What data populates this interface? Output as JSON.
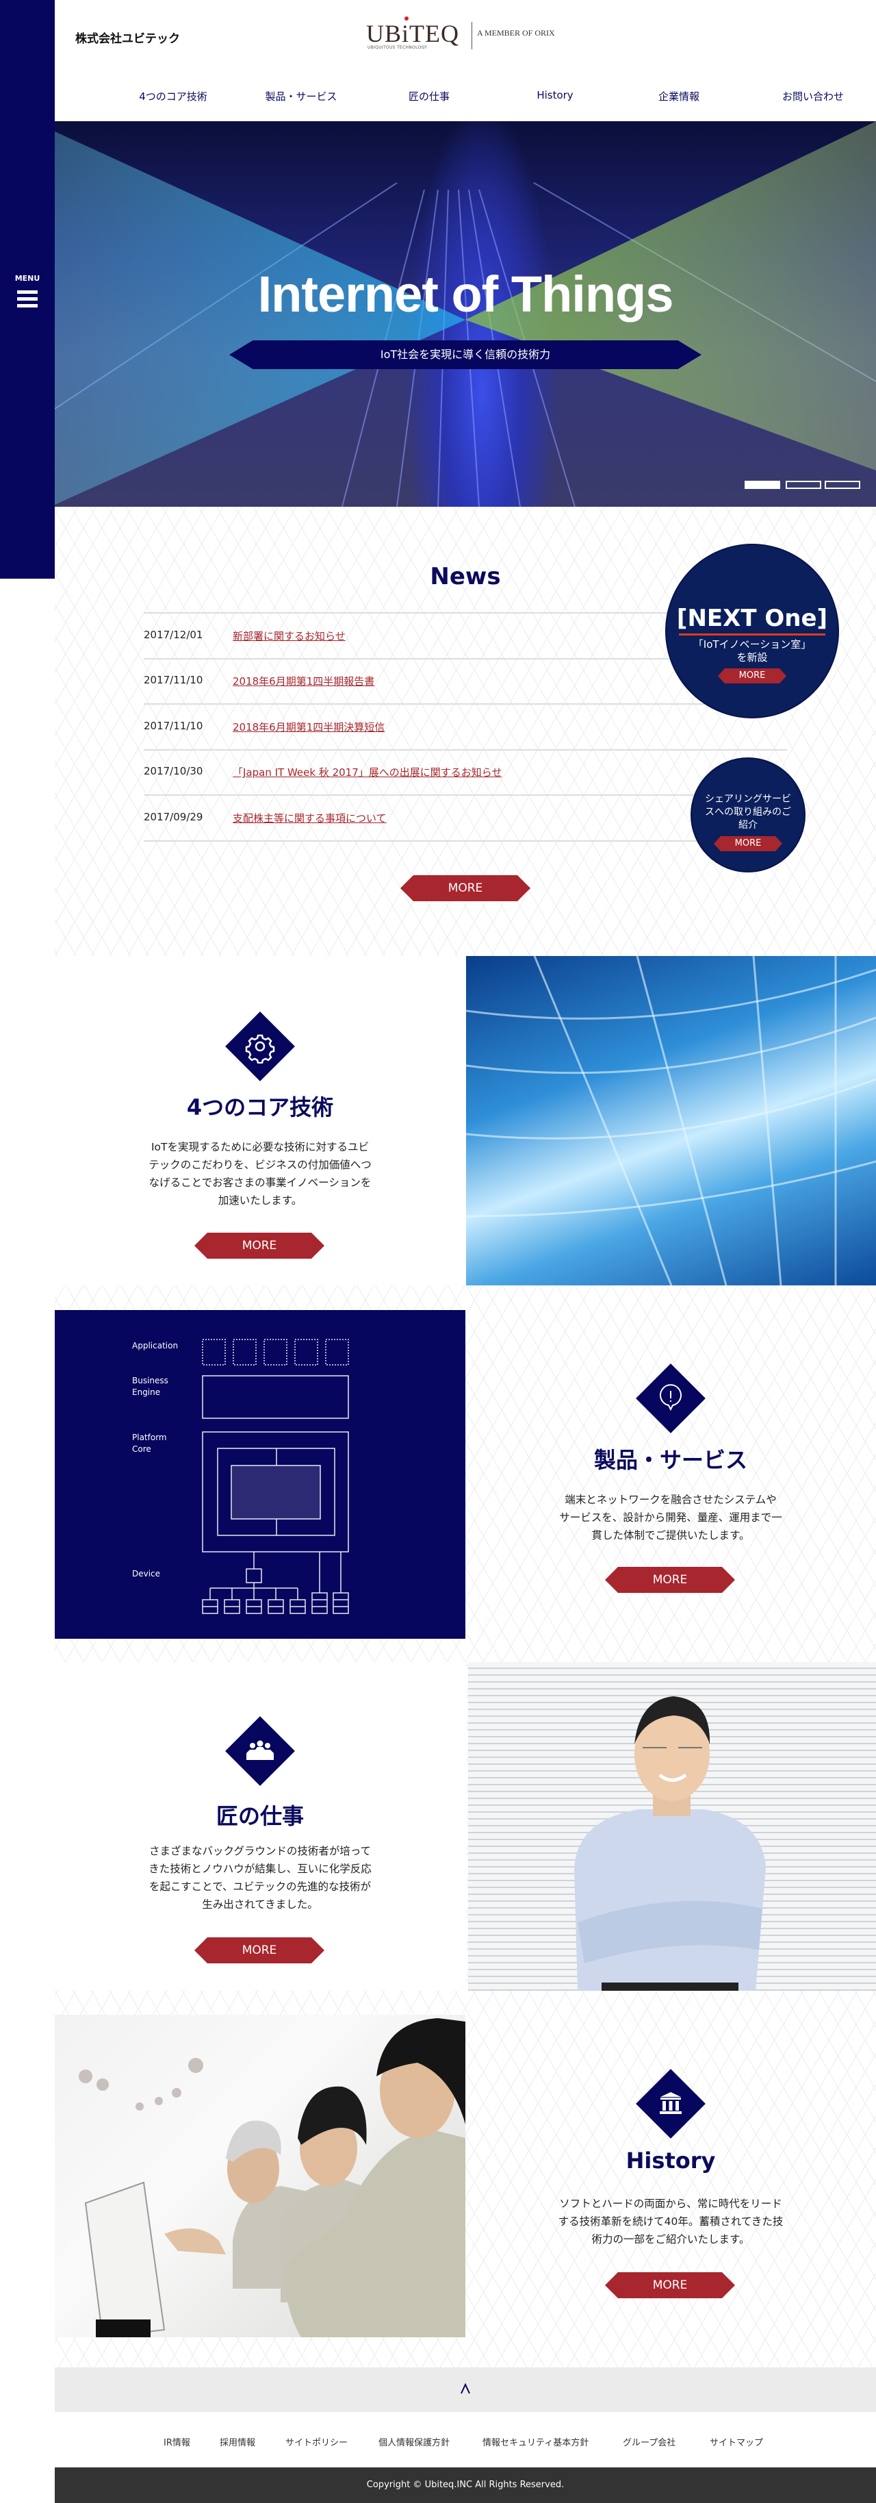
{
  "header": {
    "company_name": "株式会社ユビテック",
    "logo": {
      "brand": "UBiTEQ",
      "tagline": "UBIQUITOUS TECHNOLOGY",
      "member": "A MEMBER OF ORIX"
    },
    "nav": [
      "4つのコア技術",
      "製品・サービス",
      "匠の仕事",
      "History",
      "企業情報",
      "お問い合わせ"
    ]
  },
  "sidebar": {
    "menu_label": "MENU",
    "icon": "hamburger-icon"
  },
  "hero": {
    "title": "Internet of Things",
    "subtitle": "IoT社会を実現に導く信頼の技術力",
    "slides": {
      "count": 3,
      "active": 1
    }
  },
  "news": {
    "title": "News",
    "more": "MORE",
    "items": [
      {
        "date": "2017/12/01",
        "title": "新部署に関するお知らせ"
      },
      {
        "date": "2017/11/10",
        "title": "2018年6月期第1四半期報告書"
      },
      {
        "date": "2017/11/10",
        "title": "2018年6月期第1四半期決算短信"
      },
      {
        "date": "2017/10/30",
        "title": "「Japan IT Week 秋 2017」展への出展に関するお知らせ"
      },
      {
        "date": "2017/09/29",
        "title": "支配株主等に関する事項について"
      }
    ]
  },
  "promos": [
    {
      "title": "[NEXT One]",
      "lines": [
        "「IoTイノベーション室」",
        "を新設"
      ],
      "more": "MORE"
    },
    {
      "lines": [
        "シェアリングサービ",
        "スへの取り組みのご",
        "紹介"
      ],
      "more": "MORE"
    }
  ],
  "sections": [
    {
      "title": "4つのコア技術",
      "icon": "gear-icon",
      "lines": [
        "IoTを実現するために必要な技術に対するユビ",
        "テックのこだわりを、ビジネスの付加価値へつ",
        "なげることでお客さまの事業イノベーションを",
        "加速いたします。"
      ],
      "more": "MORE"
    },
    {
      "title": "製品・サービス",
      "icon": "speech-bubble-exclamation-icon",
      "lines": [
        "端末とネットワークを融合させたシステムや",
        "サービスを、設計から開発、量産、運用まで一",
        "貫した体制でご提供いたします。"
      ],
      "more": "MORE"
    },
    {
      "title": "匠の仕事",
      "icon": "team-icon",
      "lines": [
        "さまざまなバックグラウンドの技術者が培って",
        "きた技術とノウハウが結集し、互いに化学反応",
        "を起こすことで、ユビテックの先進的な技術が",
        "生み出されてきました。"
      ],
      "more": "MORE"
    },
    {
      "title": "History",
      "icon": "museum-icon",
      "lines": [
        "ソフトとハードの両面から、常に時代をリード",
        "する技術革新を続けて40年。蓄積されてきた技",
        "術力の一部をご紹介いたします。"
      ],
      "more": "MORE"
    }
  ],
  "diagram": {
    "application": "Application",
    "business": [
      "Business",
      "Engine"
    ],
    "platform": [
      "Platform",
      "Core"
    ],
    "device": "Device"
  },
  "footer": {
    "to_top_icon": "chevron-up-icon",
    "links": [
      "IR情報",
      "採用情報",
      "サイトポリシー",
      "個人情報保護方針",
      "情報セキュリティ基本方針",
      "グループ会社",
      "サイトマップ"
    ],
    "copyright": "Copyright © Ubiteq.INC All Rights Reserved."
  },
  "colors": {
    "navy": "#07065e",
    "accent_red": "#a8262d",
    "circle_navy": "#0b1f5c",
    "footer_dark": "#333333"
  }
}
